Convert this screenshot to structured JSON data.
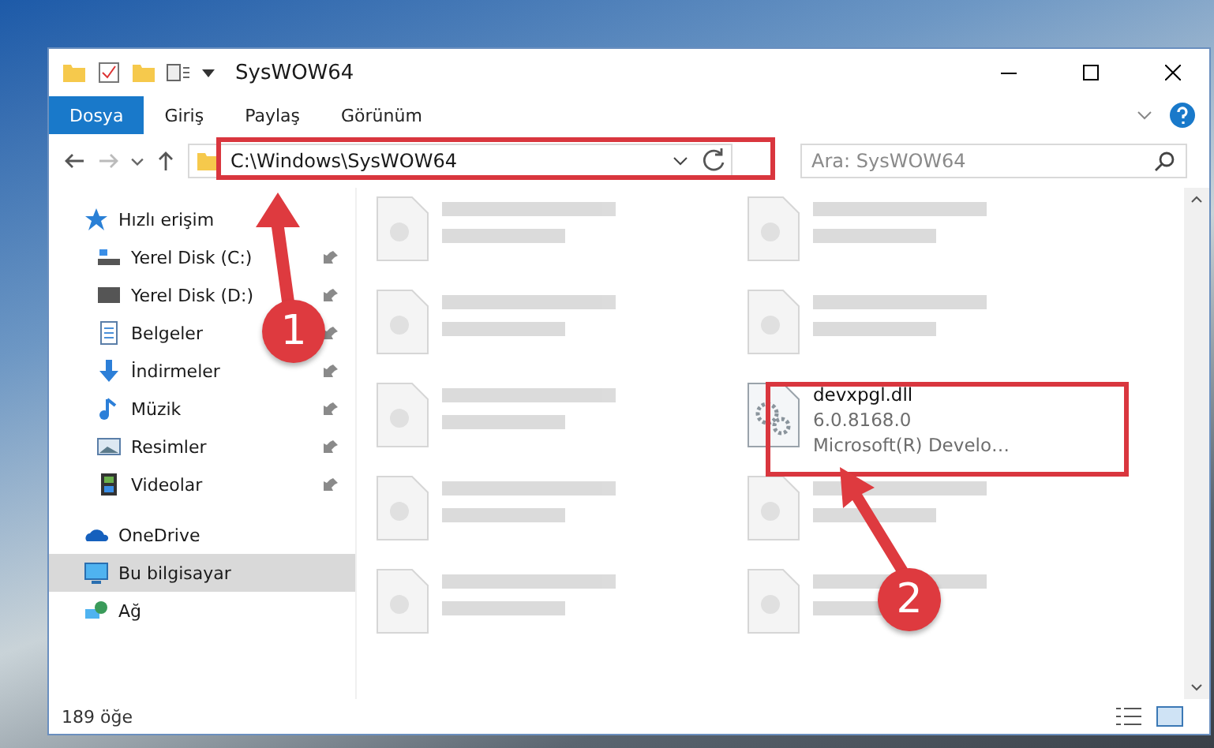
{
  "window": {
    "title": "SysWOW64"
  },
  "ribbon_tabs": [
    {
      "label": "Dosya",
      "selected": true
    },
    {
      "label": "Giriş",
      "selected": false
    },
    {
      "label": "Paylaş",
      "selected": false
    },
    {
      "label": "Görünüm",
      "selected": false
    }
  ],
  "address": {
    "path": "C:\\Windows\\SysWOW64"
  },
  "search": {
    "placeholder": "Ara: SysWOW64"
  },
  "nav": [
    {
      "label": "Hızlı erişim",
      "selected": false,
      "children": [
        {
          "label": "Yerel Disk (C:)",
          "selected": false,
          "pinned": true
        },
        {
          "label": "Yerel Disk (D:)",
          "selected": false,
          "pinned": true
        },
        {
          "label": "Belgeler",
          "selected": false,
          "pinned": true
        },
        {
          "label": "İndirmeler",
          "selected": false,
          "pinned": true
        },
        {
          "label": "Müzik",
          "selected": false,
          "pinned": true
        },
        {
          "label": "Resimler",
          "selected": false,
          "pinned": true
        },
        {
          "label": "Videolar",
          "selected": false,
          "pinned": true
        }
      ]
    },
    {
      "label": "OneDrive",
      "selected": false
    },
    {
      "label": "Bu bilgisayar",
      "selected": true
    },
    {
      "label": "Ağ",
      "selected": false
    }
  ],
  "files": [
    {
      "kind": "blurred"
    },
    {
      "kind": "blurred"
    },
    {
      "kind": "blurred"
    },
    {
      "kind": "blurred"
    },
    {
      "kind": "blurred"
    },
    {
      "kind": "file",
      "name": "devxpgl.dll",
      "lines": [
        "6.0.8168.0",
        "Microsoft(R) Develo…"
      ]
    },
    {
      "kind": "blurred"
    },
    {
      "kind": "blurred"
    },
    {
      "kind": "blurred"
    },
    {
      "kind": "blurred"
    }
  ],
  "status_bar": {
    "count": "189 öğe"
  },
  "annotations": [
    {
      "number": "1"
    },
    {
      "number": "2"
    }
  ]
}
